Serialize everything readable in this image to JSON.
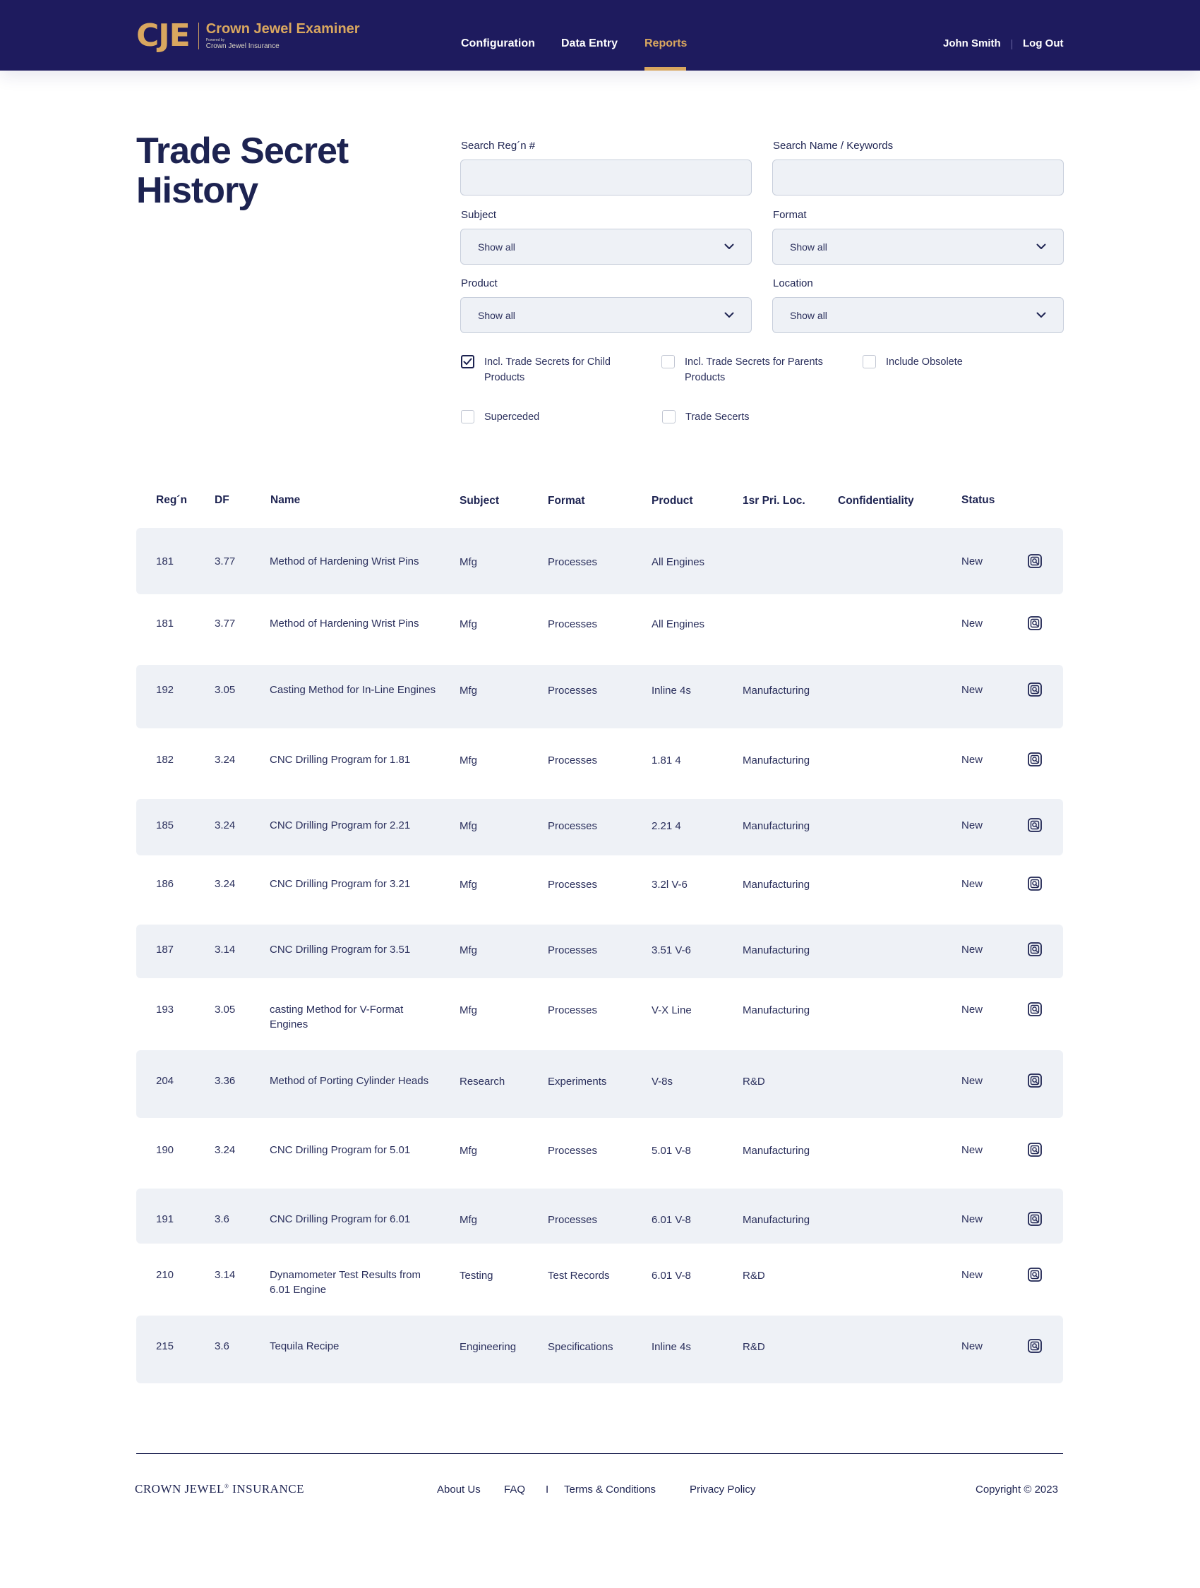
{
  "header": {
    "logo_mark": "CJE",
    "logo_title": "Crown Jewel Examiner",
    "logo_powered": "Powered by",
    "logo_sub": "Crown Jewel Insurance",
    "nav": [
      "Configuration",
      "Data Entry",
      "Reports"
    ],
    "active_nav": "Reports",
    "user_name": "John Smith",
    "logout_label": "Log Out"
  },
  "page": {
    "title": "Trade Secret History"
  },
  "filters": {
    "search_reg_label": "Search Reg´n #",
    "search_reg_value": "",
    "search_name_label": "Search Name / Keywords",
    "search_name_value": "",
    "subject_label": "Subject",
    "subject_value": "Show all",
    "format_label": "Format",
    "format_value": "Show all",
    "product_label": "Product",
    "product_value": "Show all",
    "location_label": "Location",
    "location_value": "Show all",
    "checkboxes": [
      {
        "label": "Incl. Trade Secrets for Child Products",
        "checked": true
      },
      {
        "label": "Incl. Trade Secrets for Parents Products",
        "checked": false
      },
      {
        "label": "Include Obsolete",
        "checked": false
      },
      {
        "label": "Superceded",
        "checked": false
      },
      {
        "label": "Trade Secerts",
        "checked": false
      }
    ]
  },
  "table": {
    "headers": {
      "reg": "Reg´n",
      "df": "DF",
      "name": "Name",
      "subject": "Subject",
      "format": "Format",
      "product": "Product",
      "location": "1sr Pri. Loc.",
      "confidentiality": "Confidentiality",
      "status": "Status"
    },
    "rows": [
      {
        "reg": "181",
        "df": "3.77",
        "name": "Method of Hardening Wrist Pins",
        "subject": "Mfg",
        "format": "Processes",
        "product": "All Engines",
        "location": "",
        "confidentiality": "",
        "status": "New"
      },
      {
        "reg": "181",
        "df": "3.77",
        "name": "Method of Hardening Wrist Pins",
        "subject": "Mfg",
        "format": "Processes",
        "product": "All Engines",
        "location": "",
        "confidentiality": "",
        "status": "New"
      },
      {
        "reg": "192",
        "df": "3.05",
        "name": "Casting Method for In-Line Engines",
        "subject": "Mfg",
        "format": "Processes",
        "product": "Inline 4s",
        "location": "Manufacturing",
        "confidentiality": "",
        "status": "New"
      },
      {
        "reg": "182",
        "df": "3.24",
        "name": "CNC Drilling Program for 1.81",
        "subject": "Mfg",
        "format": "Processes",
        "product": "1.81 4",
        "location": "Manufacturing",
        "confidentiality": "",
        "status": "New"
      },
      {
        "reg": "185",
        "df": "3.24",
        "name": "CNC Drilling Program for 2.21",
        "subject": "Mfg",
        "format": "Processes",
        "product": "2.21 4",
        "location": "Manufacturing",
        "confidentiality": "",
        "status": "New"
      },
      {
        "reg": "186",
        "df": "3.24",
        "name": "CNC Drilling Program for 3.21",
        "subject": "Mfg",
        "format": "Processes",
        "product": "3.2l V-6",
        "location": "Manufacturing",
        "confidentiality": "",
        "status": "New"
      },
      {
        "reg": "187",
        "df": "3.14",
        "name": "CNC Drilling Program for 3.51",
        "subject": "Mfg",
        "format": "Processes",
        "product": "3.51 V-6",
        "location": "Manufacturing",
        "confidentiality": "",
        "status": "New"
      },
      {
        "reg": "193",
        "df": "3.05",
        "name": "casting Method for V-Format Engines",
        "subject": "Mfg",
        "format": "Processes",
        "product": "V-X Line",
        "location": "Manufacturing",
        "confidentiality": "",
        "status": "New"
      },
      {
        "reg": "204",
        "df": "3.36",
        "name": "Method of Porting Cylinder Heads",
        "subject": "Research",
        "format": "Experiments",
        "product": "V-8s",
        "location": "R&D",
        "confidentiality": "",
        "status": "New"
      },
      {
        "reg": "190",
        "df": "3.24",
        "name": "CNC Drilling Program for 5.01",
        "subject": "Mfg",
        "format": "Processes",
        "product": "5.01 V-8",
        "location": "Manufacturing",
        "confidentiality": "",
        "status": "New"
      },
      {
        "reg": "191",
        "df": "3.6",
        "name": "CNC Drilling Program for 6.01",
        "subject": "Mfg",
        "format": "Processes",
        "product": "6.01 V-8",
        "location": "Manufacturing",
        "confidentiality": "",
        "status": "New"
      },
      {
        "reg": "210",
        "df": "3.14",
        "name": "Dynamometer Test Results from 6.01 Engine",
        "subject": "Testing",
        "format": "Test Records",
        "product": "6.01 V-8",
        "location": "R&D",
        "confidentiality": "",
        "status": "New"
      },
      {
        "reg": "215",
        "df": "3.6",
        "name": "Tequila Recipe",
        "subject": "Engineering",
        "format": "Specifications",
        "product": "Inline 4s",
        "location": "R&D",
        "confidentiality": "",
        "status": "New"
      }
    ],
    "row_icon": "view-document-icon"
  },
  "footer": {
    "logo_text_a": "CROWN JEWEL",
    "logo_mark": "®",
    "logo_text_b": " INSURANCE",
    "links": [
      "About Us",
      "FAQ",
      "Terms & Conditions",
      "Privacy Policy"
    ],
    "separator": "I",
    "copyright": "Copyright © 2023"
  },
  "colors": {
    "navy": "#1e1b5e",
    "gold": "#d9a75f",
    "row_shade": "#eef1f6",
    "text": "#1d2351"
  }
}
